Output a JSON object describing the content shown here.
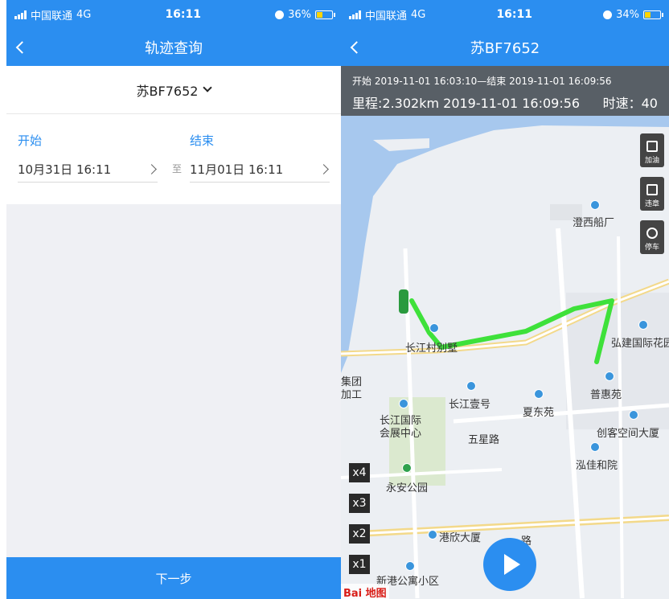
{
  "left_screen": {
    "status": {
      "carrier": "中国联通",
      "network": "4G",
      "time": "16:11",
      "battery": "36%",
      "battery_level": 0.36
    },
    "title": "轨迹查询",
    "plate": "苏BF7652",
    "start_label": "开始",
    "end_label": "结束",
    "start_value": "10月31日 16:11",
    "end_value": "11月01日 16:11",
    "to_label": "至",
    "next_button": "下一步"
  },
  "right_screen": {
    "status": {
      "carrier": "中国联通",
      "network": "4G",
      "time": "16:11",
      "battery": "34%",
      "battery_level": 0.34
    },
    "title": "苏BF7652",
    "info": {
      "range_line": "开始 2019-11-01 16:03:10—结束 2019-11-01 16:09:56",
      "mileage_line": "里程:2.302km  2019-11-01 16:09:56",
      "speed_line": "时速：40"
    },
    "side_buttons": [
      {
        "label": "加油",
        "icon": "fuel-icon"
      },
      {
        "label": "违章",
        "icon": "violation-icon"
      },
      {
        "label": "停车",
        "icon": "parking-car-icon"
      }
    ],
    "speed_buttons": [
      "x4",
      "x3",
      "x2",
      "x1"
    ],
    "map_labels": {
      "chengxi": "澄西船厂",
      "changjiang_bieshu": "长江村别墅",
      "hongjian": "弘建国际花园",
      "jituan": "集团",
      "jiagong": "加工",
      "changjiang_yihao": "长江壹号",
      "xiadongyuan": "夏东苑",
      "puhuiyuan": "普惠苑",
      "changjiang_guoji": "长江国际",
      "huizhan": "会展中心",
      "wuxinglu": "五星路",
      "chuangke": "创客空间大厦",
      "hongjiahe": "泓佳和院",
      "yongan": "永安公园",
      "gangxin": "港欣大厦",
      "xinggang": "新港公寓小区",
      "road_tail": "路"
    },
    "baidu_logo": "Bai 地图",
    "colors": {
      "accent": "#2b8ef0",
      "track": "#3ee13a"
    }
  }
}
